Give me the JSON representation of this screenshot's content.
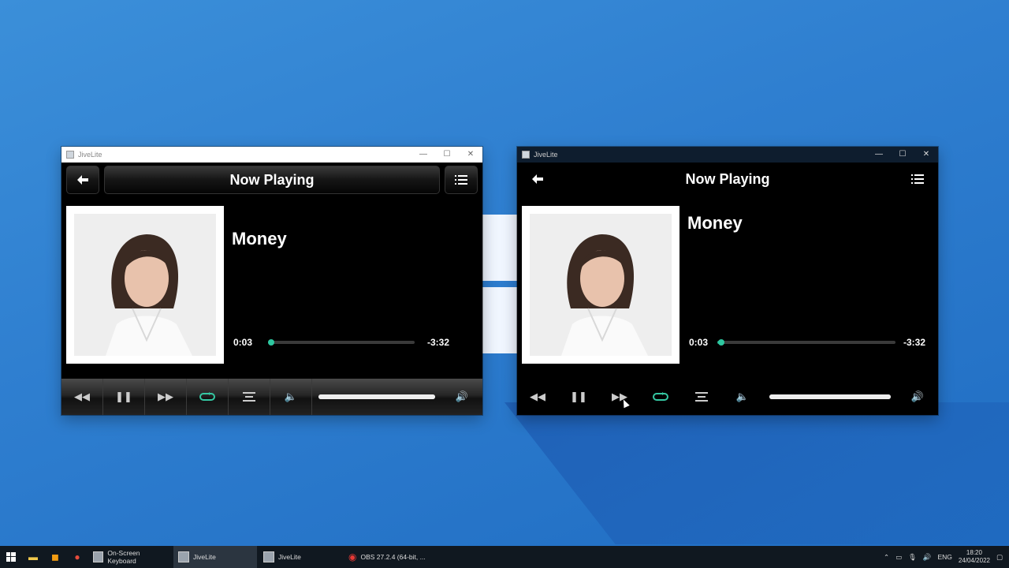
{
  "windows": [
    {
      "window_title": "JiveLite",
      "header_title": "Now Playing",
      "track_title": "Money",
      "elapsed": "0:03",
      "remaining": "-3:32",
      "progress_fraction": 0.02,
      "volume_fraction": 1.0
    },
    {
      "window_title": "JiveLite",
      "header_title": "Now Playing",
      "track_title": "Money",
      "elapsed": "0:03",
      "remaining": "-3:32",
      "progress_fraction": 0.02,
      "volume_fraction": 1.0
    }
  ],
  "icons": {
    "back": "back-arrow-icon",
    "menu": "list-icon",
    "rewind": "rewind-icon",
    "pause": "pause-icon",
    "forward": "fast-forward-icon",
    "repeat": "repeat-icon",
    "shuffle": "shuffle-icon",
    "volume_down": "volume-low-icon",
    "volume_up": "volume-high-icon"
  },
  "colors": {
    "accent": "#2ec7a0",
    "desktop": "#2f7fd0"
  },
  "taskbar": {
    "apps": [
      {
        "label": "On-Screen Keyboard"
      },
      {
        "label": "JiveLite"
      },
      {
        "label": "JiveLite"
      },
      {
        "label": "OBS 27.2.4 (64-bit, ..."
      }
    ],
    "language": "ENG",
    "time": "18:20",
    "date": "24/04/2022"
  }
}
